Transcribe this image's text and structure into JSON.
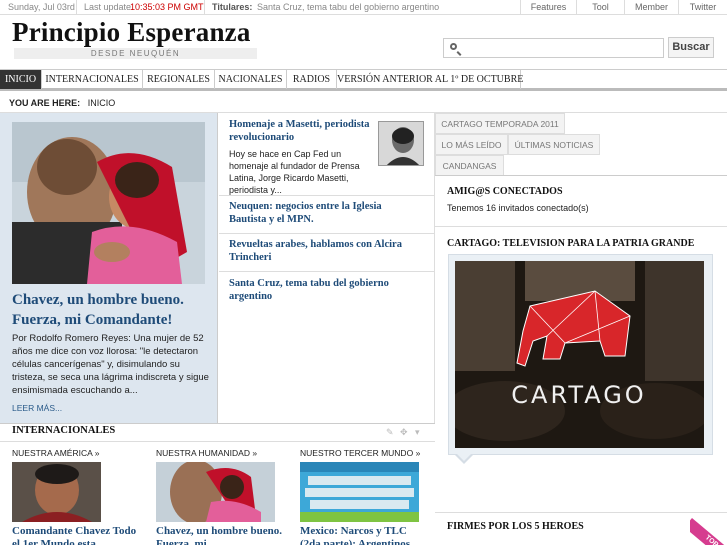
{
  "topbar": {
    "date": "Sunday, Jul 03rd",
    "last_update_label": "Last update",
    "last_update_time": "10:35:03 PM GMT",
    "titulares_label": "Titulares:",
    "titular": "Santa Cruz, tema tabu del gobierno argentino",
    "links": [
      "Features",
      "Tool",
      "Member",
      "Twitter"
    ]
  },
  "site": {
    "title": "Principio Esperanza",
    "subtitle": "DESDE NEUQUÉN"
  },
  "search": {
    "placeholder": "",
    "button_label": "Buscar"
  },
  "nav": {
    "items": [
      "INICIO",
      "INTERNACIONALES",
      "REGIONALES",
      "NACIONALES",
      "RADIOS",
      "VERSIÓN ANTERIOR AL 1º DE OCTUBRE"
    ],
    "active": "INICIO"
  },
  "breadcrumb": {
    "label": "YOU ARE HERE:",
    "current": "INICIO"
  },
  "featured": {
    "title": "Chavez, un hombre bueno. Fuerza, mi Comandante!",
    "text": "Por Rodolfo Romero Reyes: Una mujer de 52 años me dice con voz llorosa: \"le detectaron células cancerígenas\" y, disimulando su tristeza, se seca una lágrima indiscreta y sigue ensimismada escuchando a...",
    "more_label": "LEER MÁS..."
  },
  "middle_list": [
    {
      "title": "Homenaje a Masetti, periodista revolucionario",
      "text": "Hoy se hace en Cap Fed un homenaje al fundador de Prensa Latina, Jorge Ricardo Masetti, periodista y..."
    },
    {
      "title": "Neuquen: negocios entre la Iglesia Bautista y el MPN."
    },
    {
      "title": "Revueltas arabes, hablamos con Alcira Trincheri"
    },
    {
      "title": "Santa Cruz, tema tabu del gobierno argentino"
    }
  ],
  "right_tabs": {
    "row1": [
      "CARTAGO TEMPORADA 2011"
    ],
    "row2": [
      "LO MÁS LEÍDO",
      "ÚLTIMAS NOTICIAS"
    ],
    "row3": [
      "CANDANGAS"
    ]
  },
  "online_box": {
    "title": "AMIG@S CONECTADOS",
    "text": "Tenemos 16 invitados conectado(s)"
  },
  "cartago_box": {
    "title": "CARTAGO: TELEVISION PARA LA PATRIA GRANDE",
    "image_text": "CARTAGO"
  },
  "firmes_box": {
    "title": "FIRMES POR LOS 5 HEROES",
    "ribbon": "TOP"
  },
  "internacionales": {
    "title": "INTERNACIONALES",
    "columns": [
      {
        "head": "NUESTRA AMÉRICA",
        "title": "Comandante Chavez Todo el 1er Mundo esta"
      },
      {
        "head": "NUESTRA HUMANIDAD",
        "title": "Chavez, un hombre bueno. Fuerza, mi"
      },
      {
        "head": "NUESTRO TERCER MUNDO",
        "title": "Mexico: Narcos y TLC (2da parte): Argentinos"
      }
    ],
    "chevron": "»"
  },
  "colors": {
    "link_blue": "#1e4b78",
    "featured_bg": "#dde6ef",
    "nav_active": "#333333",
    "update_time_red": "#cc0000",
    "ribbon_pink": "#d63c8f"
  }
}
